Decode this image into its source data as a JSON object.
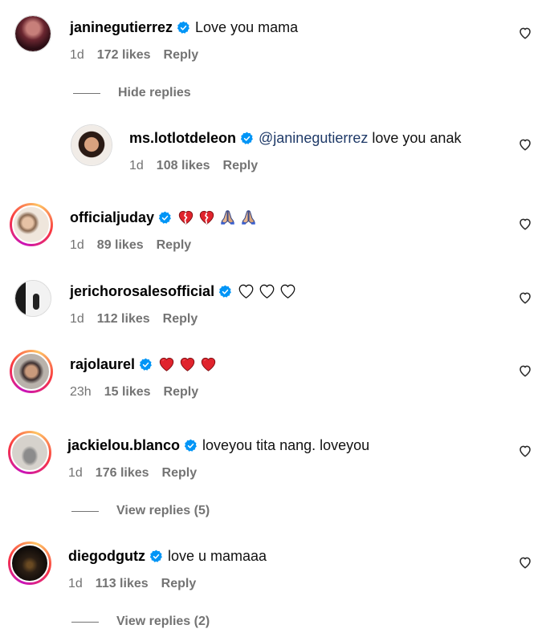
{
  "comments": [
    {
      "username": "janinegutierrez",
      "text": "Love you mama",
      "time": "1d",
      "likes": "172 likes",
      "reply": "Reply"
    },
    {
      "username": "ms.lotlotdeleon",
      "mention": "@janinegutierrez",
      "text": "love you anak",
      "time": "1d",
      "likes": "108 likes",
      "reply": "Reply"
    },
    {
      "username": "officialjuday",
      "emoji": "💔💔🙏🏼🙏🏼",
      "time": "1d",
      "likes": "89 likes",
      "reply": "Reply"
    },
    {
      "username": "jerichorosalesofficial",
      "emoji": "🤍🤍🤍",
      "time": "1d",
      "likes": "112 likes",
      "reply": "Reply"
    },
    {
      "username": "rajolaurel",
      "emoji": "❤️❤️❤️",
      "time": "23h",
      "likes": "15 likes",
      "reply": "Reply"
    },
    {
      "username": "jackielou.blanco",
      "text": "loveyou tita nang. loveyou",
      "time": "1d",
      "likes": "176 likes",
      "reply": "Reply"
    },
    {
      "username": "diegodgutz",
      "text": "love u mamaaa",
      "time": "1d",
      "likes": "113 likes",
      "reply": "Reply"
    }
  ],
  "toggles": {
    "hide_replies": "Hide replies",
    "view_replies_5": "View replies (5)",
    "view_replies_2": "View replies (2)"
  },
  "colors": {
    "verified": "#0095f6",
    "meta": "#737373",
    "mention": "#1f3a68",
    "heart_red": "#e0242d"
  },
  "icons": {
    "verified": "verified-badge-icon",
    "like": "heart-outline-icon"
  }
}
